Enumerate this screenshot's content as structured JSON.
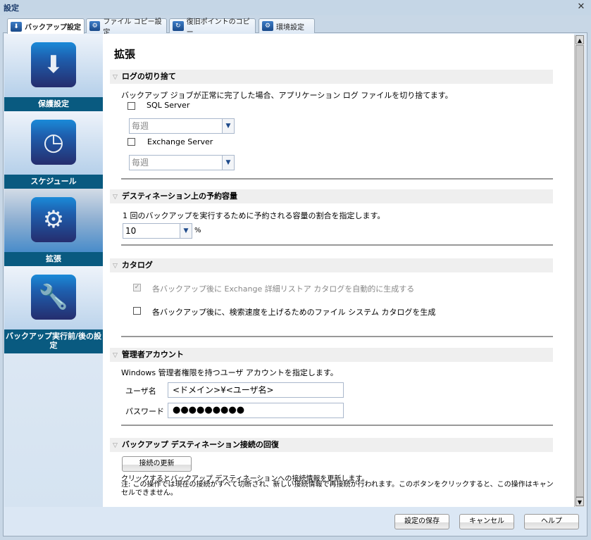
{
  "window": {
    "title": "設定",
    "close": "✕"
  },
  "tabs": [
    {
      "label": "バックアップ設定",
      "icon": "backup-icon"
    },
    {
      "label": "ファイル コピー設定",
      "icon": "file-copy-icon"
    },
    {
      "label": "復旧ポイントのコピー",
      "icon": "recovery-point-copy-icon"
    },
    {
      "label": "環境設定",
      "icon": "preferences-icon"
    }
  ],
  "sidebar": [
    {
      "label": "保護設定",
      "icon": "drive-download-icon"
    },
    {
      "label": "スケジュール",
      "icon": "clock-icon"
    },
    {
      "label": "拡張",
      "icon": "gears-icon"
    },
    {
      "label": "バックアップ実行前/後の設定",
      "icon": "wrench-icon"
    }
  ],
  "main": {
    "title": "拡張",
    "log": {
      "header": "ログの切り捨て",
      "desc": "バックアップ ジョブが正常に完了した場合、アプリケーション ログ ファイルを切り捨てます。",
      "sql_label": "SQL Server",
      "sql_checked": false,
      "sql_freq": "毎週",
      "exch_label": "Exchange Server",
      "exch_checked": false,
      "exch_freq": "毎週"
    },
    "reserve": {
      "header": "デスティネーション上の予約容量",
      "desc": "1 回のバックアップを実行するために予約される容量の割合を指定します。",
      "value": "10",
      "unit": "%"
    },
    "catalog": {
      "header": "カタログ",
      "exch_label": "各バックアップ後に Exchange 詳細リストア カタログを自動的に生成する",
      "exch_checked": true,
      "fs_label": "各バックアップ後に、検索速度を上げるためのファイル システム カタログを生成",
      "fs_checked": false
    },
    "admin": {
      "header": "管理者アカウント",
      "desc": "Windows 管理者権限を持つユーザ アカウントを指定します。",
      "user_label": "ユーザ名",
      "user_value": "<ドメイン>¥<ユーザ名>",
      "pw_label": "パスワード",
      "pw_value": "●●●●●●●●●"
    },
    "reconnect": {
      "header": "バックアップ デスティネーション接続の回復",
      "button": "接続の更新",
      "line1": "クリックするとバックアップ デスティネーションへの接続情報を更新します。",
      "line2": "注: この操作では現在の接続がすべて切断され、新しい接続情報で再接続が行われます。このボタンをクリックすると、この操作はキャンセルできません。"
    }
  },
  "footer": {
    "save": "設定の保存",
    "cancel": "キャンセル",
    "help": "ヘルプ"
  }
}
